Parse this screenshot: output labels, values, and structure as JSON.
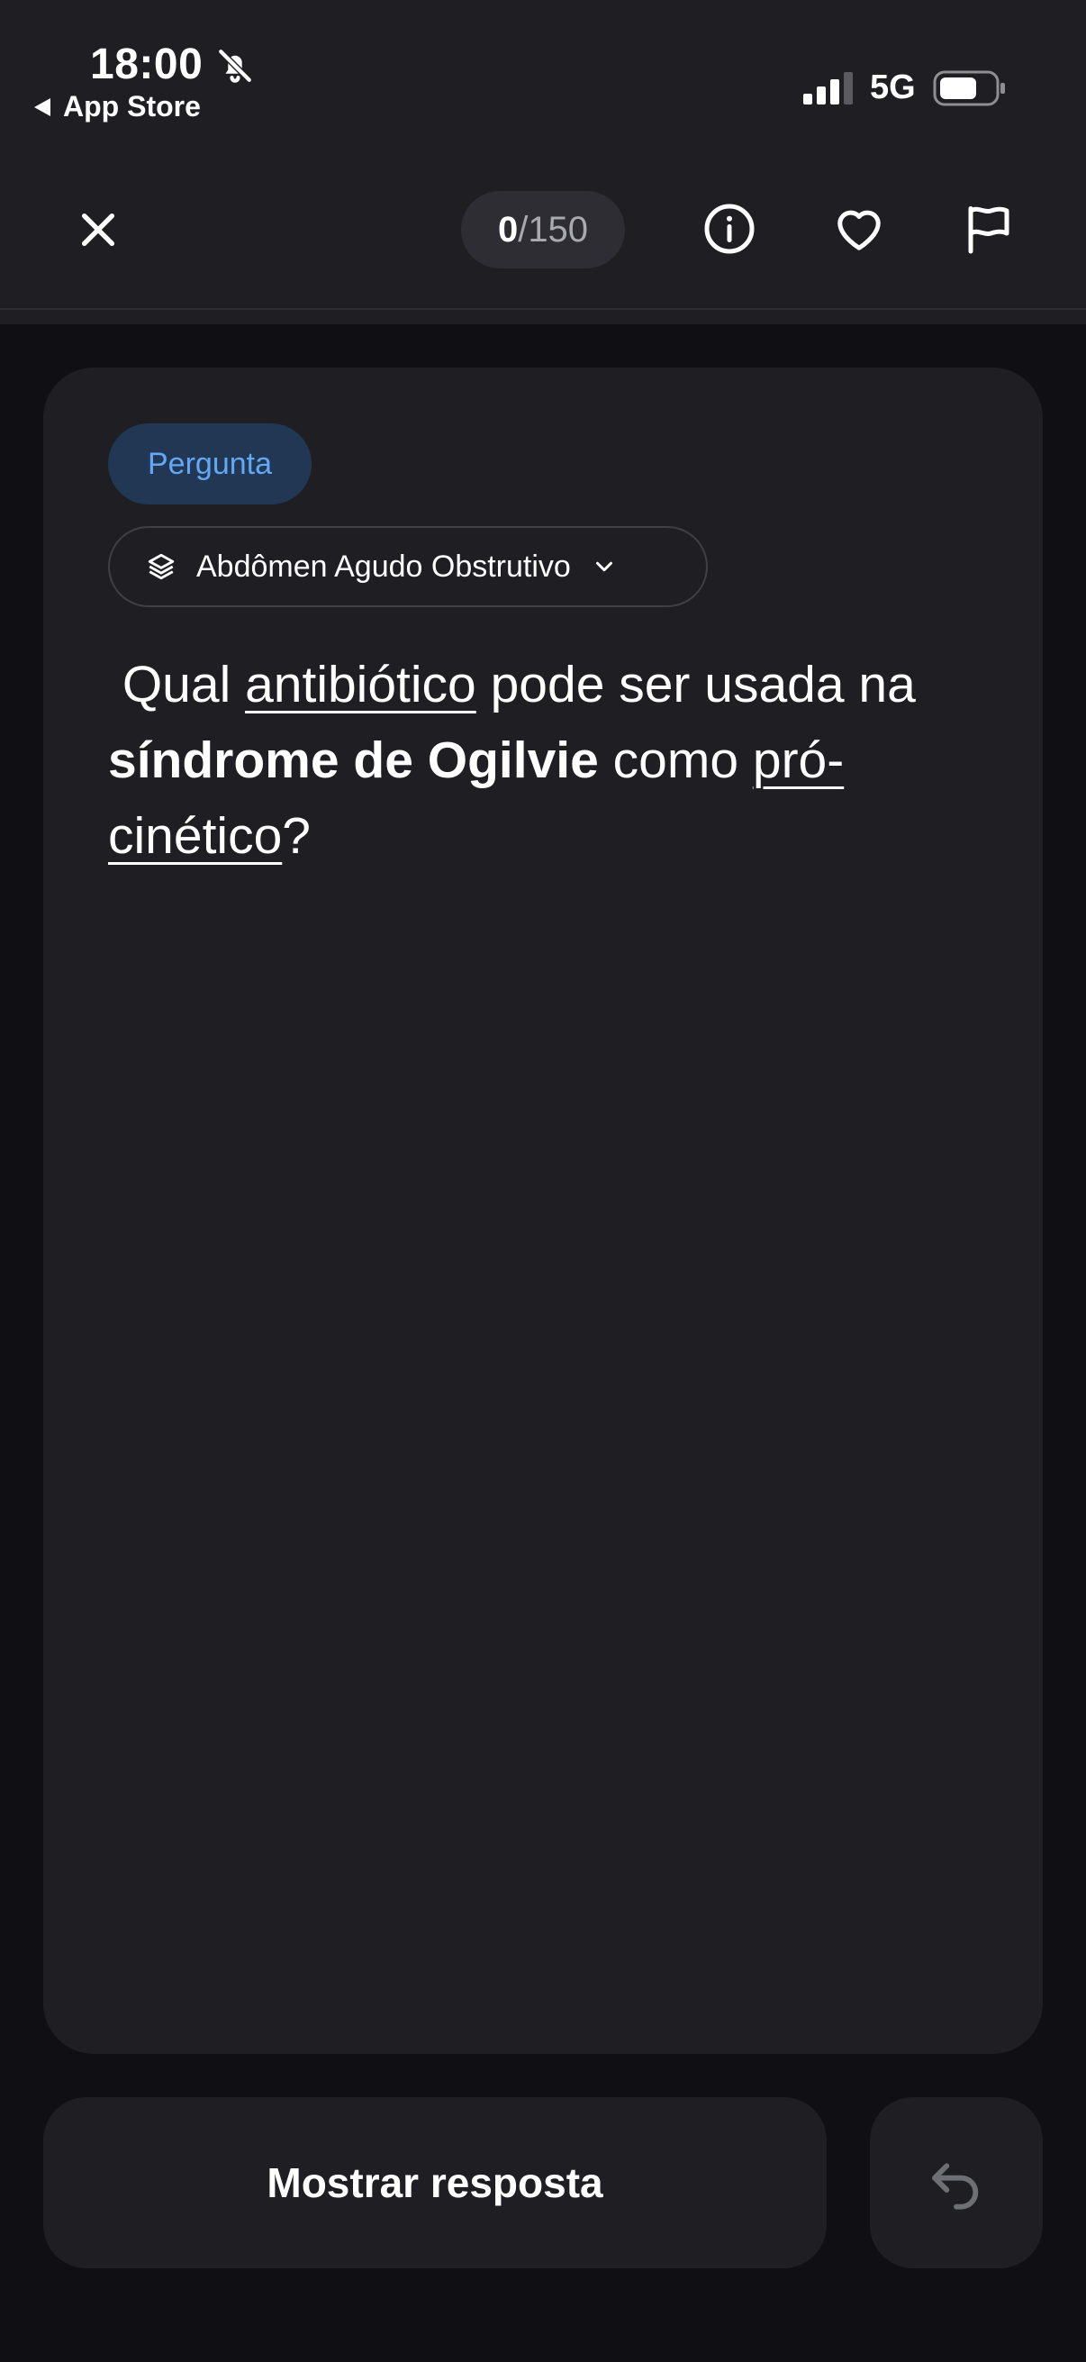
{
  "status_bar": {
    "time": "18:00",
    "back_label": "App Store",
    "network": "5G",
    "icons": [
      "bell-slash-icon",
      "signal-icon",
      "battery-icon"
    ]
  },
  "nav": {
    "counter_current": "0",
    "counter_separator": "/",
    "counter_total": "150",
    "icons": [
      "close-icon",
      "info-icon",
      "heart-icon",
      "flag-icon"
    ]
  },
  "card": {
    "badge": "Pergunta",
    "topic": "Abdômen Agudo Obstrutivo",
    "question": {
      "p1": " Qual ",
      "u1": "antibiótico",
      "p2": " pode ser usada na ",
      "b1": "síndrome de Ogilvie",
      "p3": " como ",
      "u2": "pró-cinético",
      "p4": "?"
    }
  },
  "actions": {
    "show_answer": "Mostrar resposta",
    "undo_icon": "undo-icon"
  },
  "colors": {
    "background": "#101014",
    "surface": "#1e1e23",
    "badge_bg": "#223754",
    "badge_text": "#62a8f5"
  }
}
